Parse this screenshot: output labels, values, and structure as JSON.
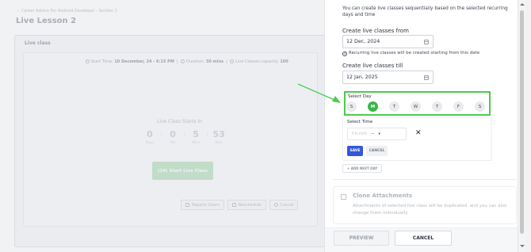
{
  "background": {
    "breadcrumb": "Career Advice For Android Developer - Section 1",
    "title": "Live Lesson 2",
    "card_title": "Live class",
    "meta": {
      "start_label": "Start Time",
      "start_value": "10 December, 24 - 6:15 PM",
      "duration_label": "Duration",
      "duration_value": "30 mins",
      "capacity_label": "Live Classes capacity",
      "capacity_value": "100"
    },
    "starts_in": "Live Class Starts In",
    "countdown": [
      {
        "value": "0",
        "unit": "Days"
      },
      {
        "value": "0",
        "unit": "Hrs"
      },
      {
        "value": "5",
        "unit": "Mins"
      },
      {
        "value": "53",
        "unit": "Secs"
      }
    ],
    "join_label": "(24)  Start Live Class",
    "actions": [
      "Reports Users",
      "Reschedule",
      "Cancel"
    ]
  },
  "drawer": {
    "intro": "You can create live classes sequentially based on the selected recurring days and time",
    "from_label": "Create live classes from",
    "from_value": "12 Dec, 2024",
    "info_note": "Recurring live classes will be created starting from this date",
    "till_label": "Create live classes till",
    "till_value": "12 Jan, 2025",
    "select_day_label": "Select Day",
    "days": [
      {
        "label": "S",
        "selected": false
      },
      {
        "label": "M",
        "selected": true
      },
      {
        "label": "T",
        "selected": false
      },
      {
        "label": "W",
        "selected": false
      },
      {
        "label": "T",
        "selected": false
      },
      {
        "label": "F",
        "selected": false
      },
      {
        "label": "S",
        "selected": false
      }
    ],
    "select_time_label": "Select Time",
    "time_placeholder": "hh:mm",
    "ampm_value": "--",
    "save_label": "SAVE",
    "cancel_small_label": "CANCEL",
    "add_next_day_label": "+ ADD NEXT DAY",
    "clone_title": "Clone Attachments",
    "clone_desc": "Attachments of selected live class will be duplicated, and you can also change them individually",
    "preview_label": "PREVIEW",
    "cancel_label": "CANCEL"
  },
  "colors": {
    "selected_day": "#3cb54a",
    "highlight_border": "#4ccb4c",
    "annotation_arrow": "#4ccb4c",
    "save_button": "#3557d9"
  }
}
